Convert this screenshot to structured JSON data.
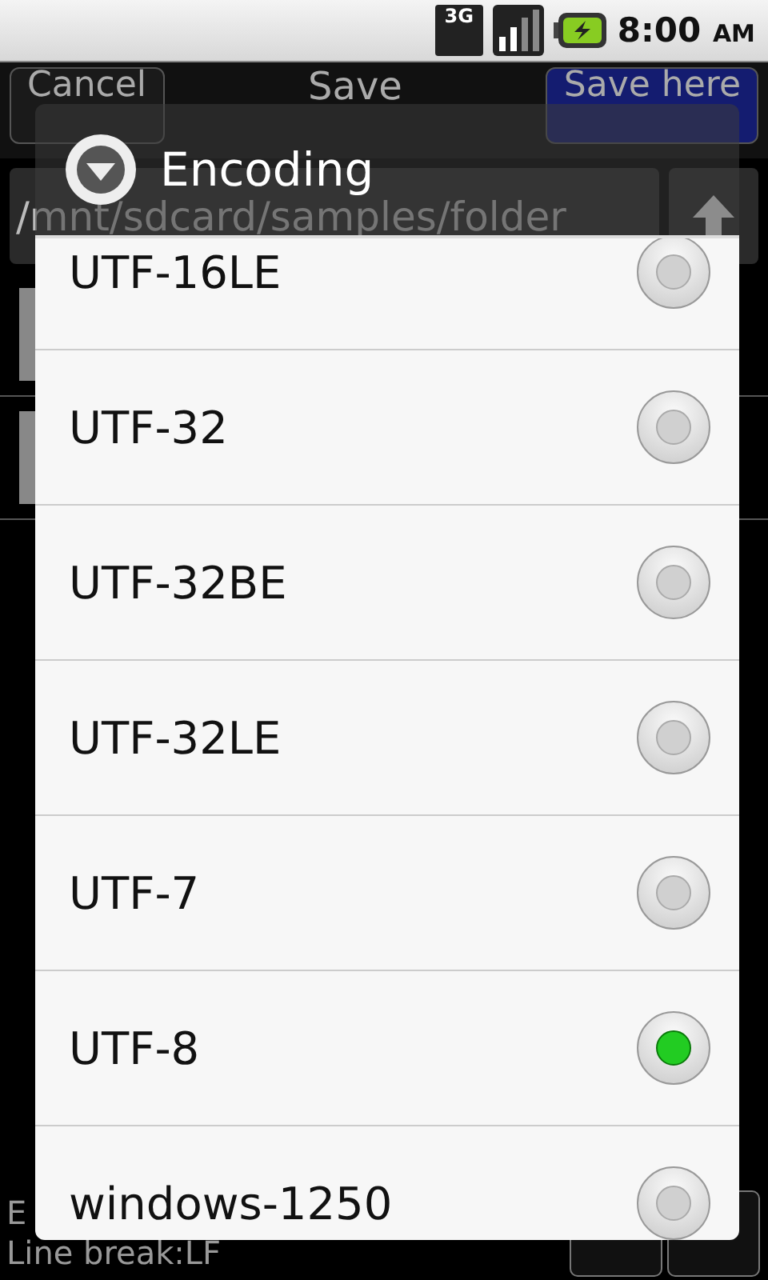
{
  "status_bar": {
    "network": "3G",
    "time": "8:00",
    "ampm": "AM"
  },
  "toolbar": {
    "cancel": "Cancel",
    "title": "Save",
    "save_here": "Save here"
  },
  "path": "/mnt/sdcard/samples/folder",
  "footer": {
    "encoding_label": "E",
    "line_break": "Line break:LF"
  },
  "dialog": {
    "title": "Encoding",
    "options": [
      {
        "label": "UTF-16LE",
        "selected": false
      },
      {
        "label": "UTF-32",
        "selected": false
      },
      {
        "label": "UTF-32BE",
        "selected": false
      },
      {
        "label": "UTF-32LE",
        "selected": false
      },
      {
        "label": "UTF-7",
        "selected": false
      },
      {
        "label": "UTF-8",
        "selected": true
      },
      {
        "label": "windows-1250",
        "selected": false
      }
    ]
  }
}
